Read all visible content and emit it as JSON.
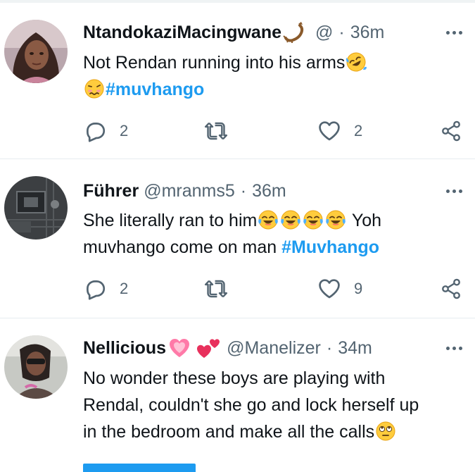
{
  "colors": {
    "accent": "#1d9bf0",
    "secondary_text": "#536471",
    "primary_text": "#0f1419",
    "divider": "#e6ecf0"
  },
  "icons": {
    "reply": "reply-icon",
    "retweet": "retweet-icon",
    "like": "heart-icon",
    "share": "share-icon",
    "more": "more-options-icon"
  },
  "tweets": [
    {
      "name": "NtandokaziMacingwane",
      "name_emoji": "scorpion",
      "handle": "@",
      "separator": "·",
      "time": "36m",
      "text_line1": "Not Rendan running into his arms",
      "text_line1_emoji": "rolling-on-floor-laughing",
      "text_line2_emoji": "woozy-face",
      "hashtag": "#muvhango",
      "replies": "2",
      "retweets": "",
      "likes": "2"
    },
    {
      "name": "Führer",
      "handle": "@mranms5",
      "separator": "·",
      "time": "36m",
      "text_line1": "She literally ran to him",
      "text_line1_emojis": [
        "face-with-tears-of-joy",
        "face-with-tears-of-joy",
        "face-with-tears-of-joy",
        "face-with-tears-of-joy"
      ],
      "text_line1_end": " Yoh",
      "text_line2": "muvhango come on man ",
      "hashtag": "#Muvhango",
      "replies": "2",
      "retweets": "",
      "likes": "9"
    },
    {
      "name": "Nellicious",
      "name_emojis": [
        "growing-heart",
        "two-hearts"
      ],
      "handle": "@Manelizer",
      "separator": "·",
      "time": "34m",
      "text_line1": "No wonder these boys are playing with",
      "text_line2": "Rendal, couldn't she go and lock herself up",
      "text_line3": "in the bedroom and make all the calls",
      "text_line3_emoji": "face-with-rolling-eyes"
    }
  ]
}
